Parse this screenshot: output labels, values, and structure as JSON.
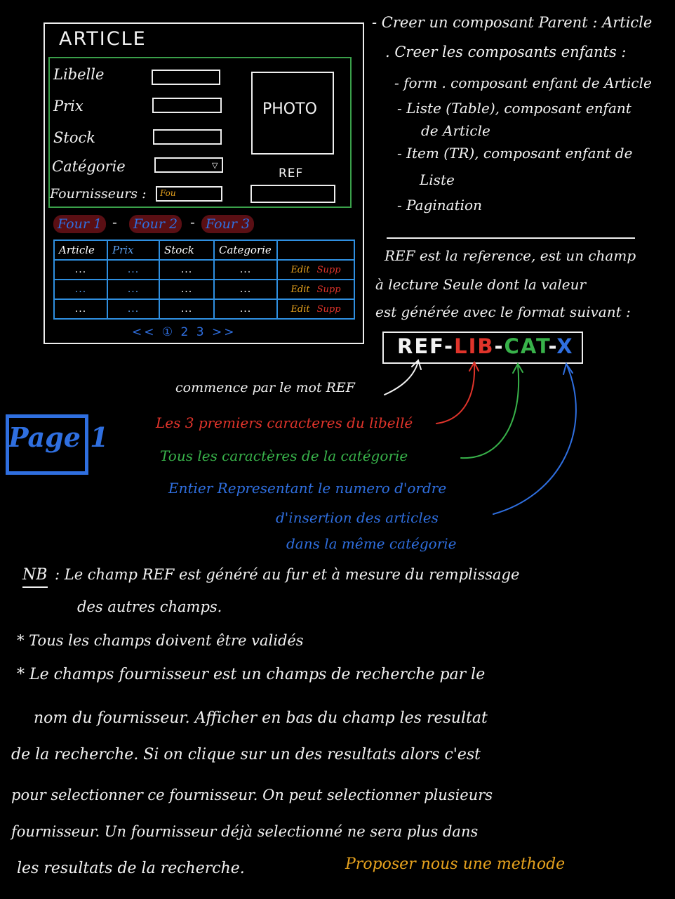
{
  "mockup": {
    "title": "ARTICLE",
    "fields": {
      "libelle": "Libelle",
      "prix": "Prix",
      "stock": "Stock",
      "categorie": "Catégorie",
      "fournisseurs": "Fournisseurs :"
    },
    "fournisseur_input_value": "Fou",
    "photo_label": "PHOTO",
    "ref_label": "REF",
    "fournisseur_chips": [
      "Four 1",
      "Four 2",
      "Four 3"
    ],
    "separator": "-",
    "table": {
      "headers": [
        "Article",
        "Prix",
        "Stock",
        "Categorie",
        ""
      ],
      "rows": [
        [
          "...",
          "...",
          "...",
          "...",
          "Edit",
          "Supp"
        ],
        [
          "...",
          "...",
          "...",
          "...",
          "Edit",
          "Supp"
        ],
        [
          "...",
          "...",
          "...",
          "...",
          "Edit",
          "Supp"
        ]
      ]
    },
    "pagination": "<< ① 2 3 >>"
  },
  "instructions": {
    "line1": "- Creer un composant Parent : Article",
    "line2": ". Creer les composants enfants :",
    "item1": "- form . composant enfant de Article",
    "item2a": "- Liste (Table), composant enfant",
    "item2b": "de Article",
    "item3a": "- Item (TR), composant enfant de",
    "item3b": "Liste",
    "item4": "- Pagination"
  },
  "ref_desc": {
    "line1": "REF est la reference, est un champ",
    "line2": "à lecture Seule dont la valeur",
    "line3": "est générée avec le format suivant :"
  },
  "ref_format": {
    "ref": "REF-",
    "lib": "LIB",
    "dash1": "-",
    "cat": "CAT",
    "dash2": "-",
    "x": "X"
  },
  "annotations": {
    "ref_word": "commence par le mot REF",
    "lib": "Les 3 premiers caracteres du libellé",
    "cat": "Tous les caractères de la catégorie",
    "x1": "Entier Representant le numero d'ordre",
    "x2": "d'insertion des articles",
    "x3": "dans la même catégorie"
  },
  "page_badge": "Page 1",
  "notes": {
    "nb_label": "NB",
    "nb_line1": ": Le champ REF est généré au fur et à mesure du remplissage",
    "nb_line2": "des autres champs.",
    "bullet1": "* Tous les champs doivent être validés",
    "bullet2": "* Le champs fournisseur est un champs de recherche par le",
    "p1": "nom du fournisseur. Afficher en bas du champ les resultat",
    "p2": "de la recherche. Si on clique sur un des resultats alors c'est",
    "p3": "pour selectionner ce fournisseur. On peut selectionner plusieurs",
    "p4": "fournisseur. Un fournisseur déjà selectionné ne sera plus dans",
    "p5": "les resultats de la recherche.",
    "p5_orange": "Proposer nous une methode"
  },
  "colors": {
    "background": "#000000",
    "white": "#f2f2f2",
    "red": "#e0342b",
    "green": "#38b24a",
    "blue": "#2f6fe0",
    "orange": "#e6a21e"
  }
}
